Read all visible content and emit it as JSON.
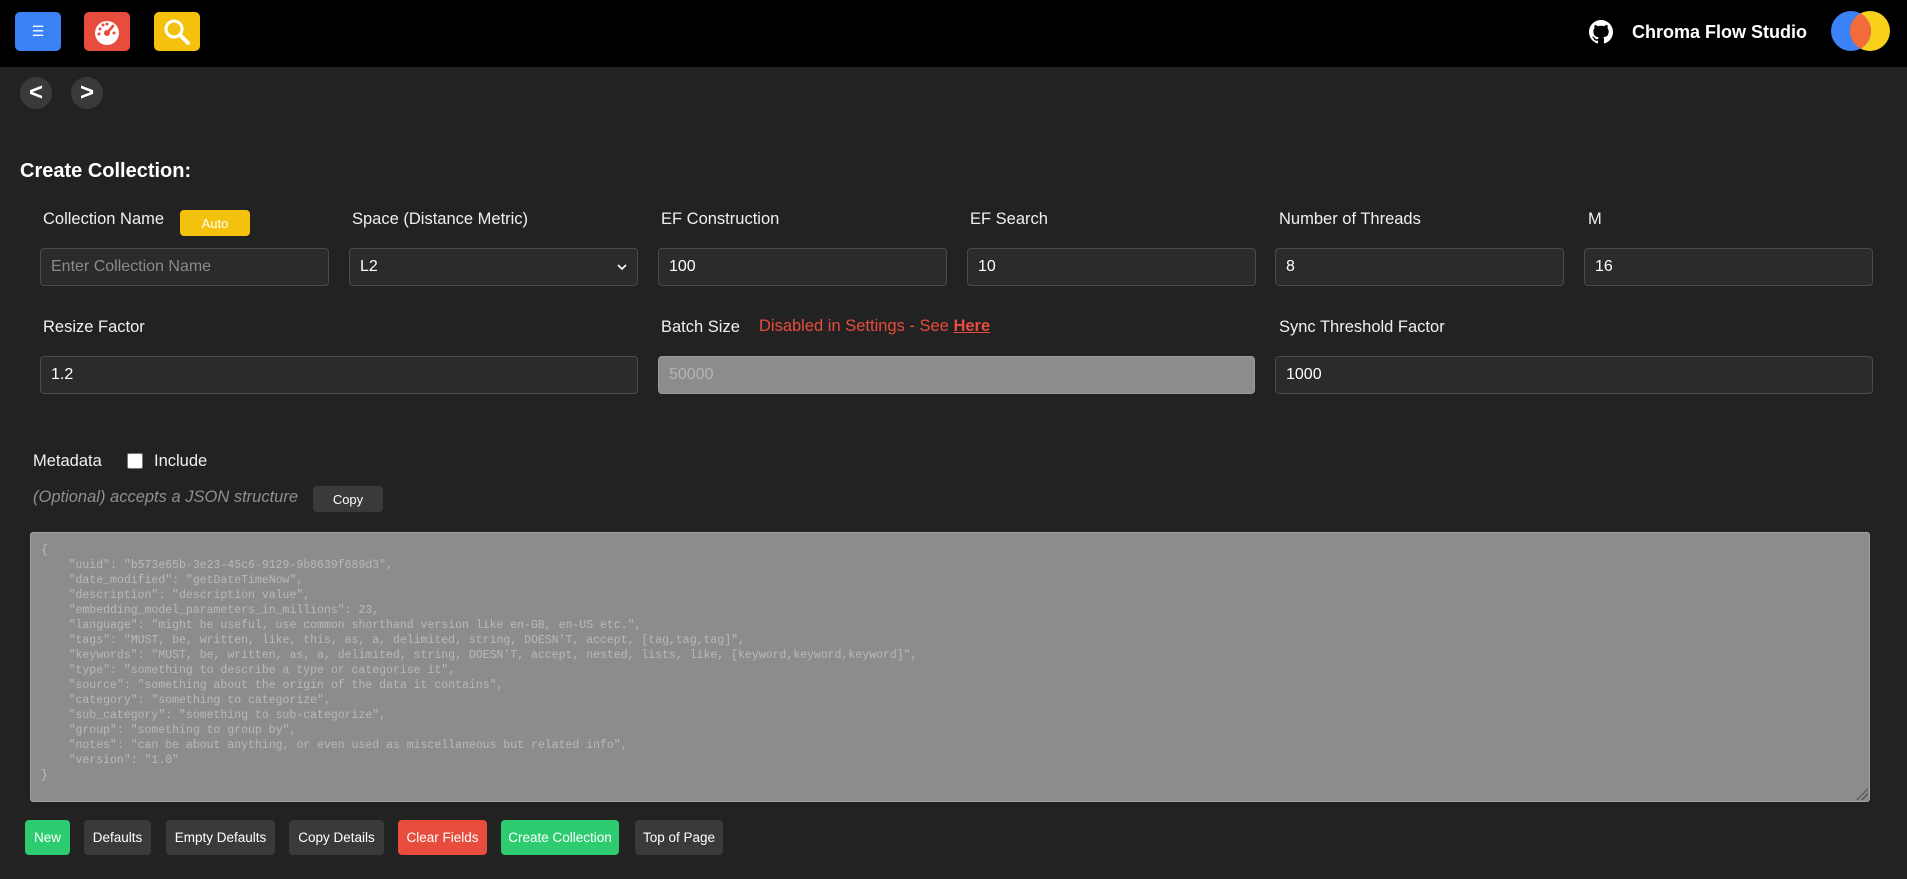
{
  "header": {
    "menu_icon": "hamburger-icon",
    "dashboard_icon": "speedometer-icon",
    "search_icon": "magnifier-icon",
    "github_icon": "github-icon",
    "app_title": "Chroma Flow Studio",
    "colors": {
      "menu": "#3b82f6",
      "dashboard": "#e74c3c",
      "search": "#f4c20d"
    }
  },
  "nav": {
    "back": "<",
    "forward": ">"
  },
  "form": {
    "title": "Create Collection:",
    "collection_name": {
      "label": "Collection Name",
      "auto_label": "Auto",
      "placeholder": "Enter Collection Name",
      "value": ""
    },
    "space": {
      "label": "Space (Distance Metric)",
      "value": "L2"
    },
    "ef_construction": {
      "label": "EF Construction",
      "value": "100"
    },
    "ef_search": {
      "label": "EF Search",
      "value": "10"
    },
    "num_threads": {
      "label": "Number of Threads",
      "value": "8"
    },
    "m": {
      "label": "M",
      "value": "16"
    },
    "resize_factor": {
      "label": "Resize Factor",
      "value": "1.2"
    },
    "batch_size": {
      "label": "Batch Size",
      "placeholder": "50000",
      "disabled_msg": "Disabled in Settings - See ",
      "disabled_link": "Here"
    },
    "sync_threshold": {
      "label": "Sync Threshold Factor",
      "value": "1000"
    }
  },
  "metadata": {
    "label": "Metadata",
    "include_label": "Include",
    "include_checked": false,
    "optional_text": "(Optional) accepts a JSON structure",
    "copy_label": "Copy",
    "json_placeholder": "{\n    \"uuid\": \"b573e65b-3e23-45c6-9129-9b8639f689d3\",\n    \"date_modified\": \"getDateTimeNow\",\n    \"description\": \"description value\",\n    \"embedding_model_parameters_in_millions\": 23,\n    \"language\": \"might be useful, use common shorthand version like en-GB, en-US etc.\",\n    \"tags\": \"MUST, be, written, like, this, as, a, delimited, string, DOESN'T, accept, [tag,tag,tag]\",\n    \"keywords\": \"MUST, be, written, as, a, delimited, string, DOESN'T, accept, nested, lists, like, [keyword,keyword,keyword]\",\n    \"type\": \"something to describe a type or categorise it\",\n    \"source\": \"something about the origin of the data it contains\",\n    \"category\": \"something to categorize\",\n    \"sub_category\": \"something to sub-categorize\",\n    \"group\": \"something to group by\",\n    \"notes\": \"can be about anything, or even used as miscellaneous but related info\",\n    \"version\": \"1.0\"\n}"
  },
  "actions": {
    "new": "New",
    "defaults": "Defaults",
    "empty_defaults": "Empty Defaults",
    "copy_details": "Copy Details",
    "clear_fields": "Clear Fields",
    "create_collection": "Create Collection",
    "top_of_page": "Top of Page"
  }
}
